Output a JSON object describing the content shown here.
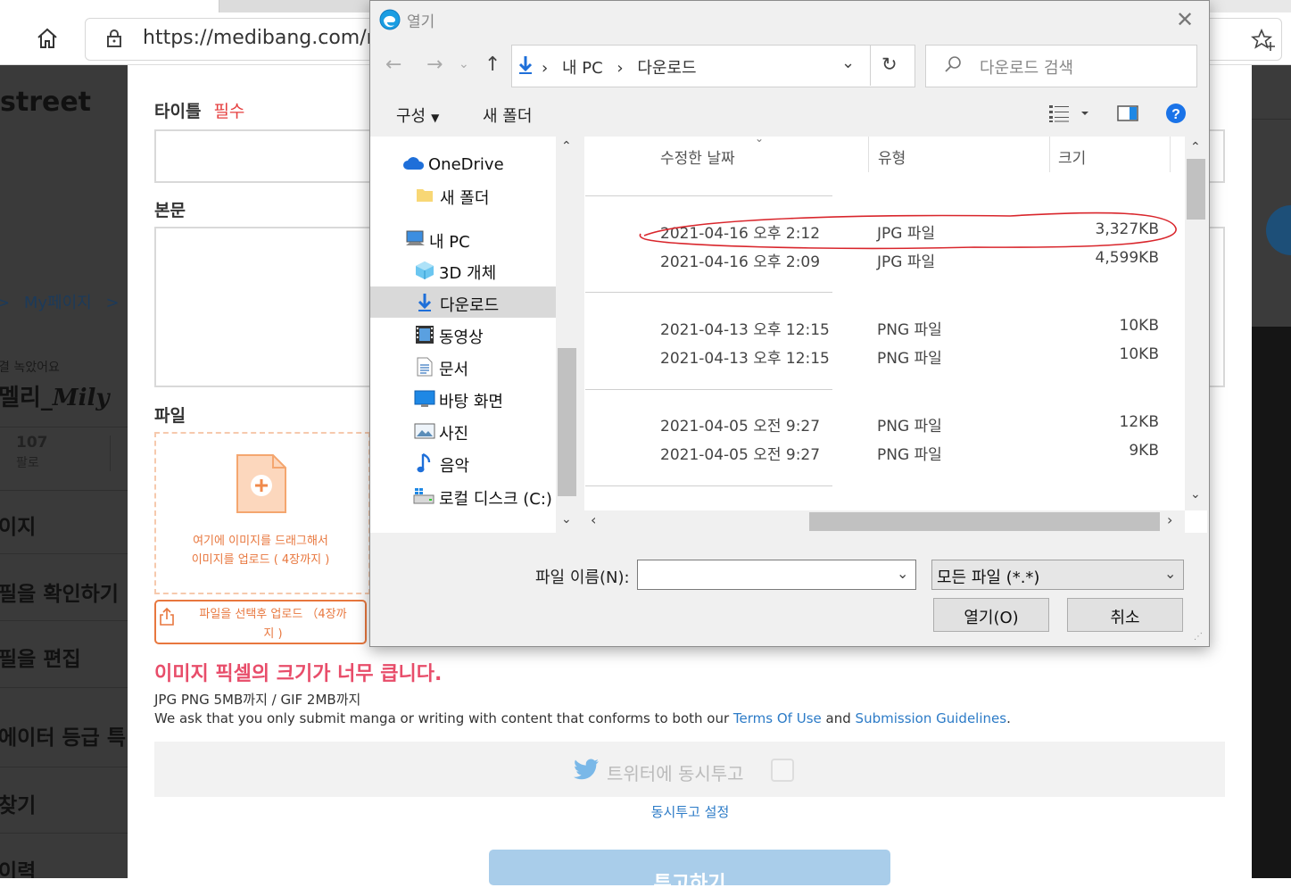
{
  "browser": {
    "url": "https://medibang.com/r"
  },
  "bg_page": {
    "brand_fragment": "street",
    "breadcrumb_sep": ">",
    "breadcrumb_mypage": "My페이지",
    "breadcrumb_sep2": ">",
    "status_fragment": "결 녹았어요",
    "username_fragment": "멜리_",
    "username_script": "Mily",
    "followers_count": "107",
    "followers_label": "팔로",
    "menu": [
      "이지",
      "필을 확인하기",
      "필을 편집",
      "에이터 등급 특",
      "찾기",
      "이력"
    ]
  },
  "form": {
    "title_label": "타이틀",
    "required_label": "필수",
    "body_label": "본문",
    "file_label": "파일",
    "dropzone_line1": "여기에 이미지를 드래그해서",
    "dropzone_line2": "이미지를 업로드 ( 4장까지 )",
    "upload_line1": "파일을 선택후 업로드 （4장까",
    "upload_line2": "지 )",
    "error_message": "이미지 픽셀의 크기가 너무 큽니다.",
    "format_note": "JPG PNG 5MB까지 / GIF 2MB까지",
    "submit_note_prefix": "We ask that you only submit manga or writing with content that conforms to both our",
    "terms_link": "Terms Of Use",
    "and_text": "and",
    "guidelines_link": "Submission Guidelines",
    "period": ".",
    "twitter_label": "트위터에 동시투고",
    "twitter_settings": "동시투고 설정",
    "submit_button": "투고하기"
  },
  "dialog": {
    "title": "열기",
    "path": [
      "내 PC",
      "다운로드"
    ],
    "search_placeholder": "다운로드 검색",
    "organize_label": "구성",
    "new_folder_label": "새 폴더",
    "nav_items": [
      {
        "label": "OneDrive",
        "icon": "cloud-icon"
      },
      {
        "label": "새 폴더",
        "icon": "folder-icon"
      },
      {
        "label": "내 PC",
        "icon": "computer-icon"
      },
      {
        "label": "3D 개체",
        "icon": "cube-icon"
      },
      {
        "label": "다운로드",
        "icon": "download-icon"
      },
      {
        "label": "동영상",
        "icon": "video-icon"
      },
      {
        "label": "문서",
        "icon": "document-icon"
      },
      {
        "label": "바탕 화면",
        "icon": "desktop-icon"
      },
      {
        "label": "사진",
        "icon": "picture-icon"
      },
      {
        "label": "음악",
        "icon": "music-icon"
      },
      {
        "label": "로컬 디스크 (C:)",
        "icon": "disk-icon"
      }
    ],
    "columns": [
      "수정한 날짜",
      "유형",
      "크기"
    ],
    "files": [
      {
        "date": "2021-04-16 오후 2:12",
        "type": "JPG 파일",
        "size": "3,327KB"
      },
      {
        "date": "2021-04-16 오후 2:09",
        "type": "JPG 파일",
        "size": "4,599KB"
      },
      {
        "date": "2021-04-13 오후 12:15",
        "type": "PNG 파일",
        "size": "10KB"
      },
      {
        "date": "2021-04-13 오후 12:15",
        "type": "PNG 파일",
        "size": "10KB"
      },
      {
        "date": "2021-04-05 오전 9:27",
        "type": "PNG 파일",
        "size": "12KB"
      },
      {
        "date": "2021-04-05 오전 9:27",
        "type": "PNG 파일",
        "size": "9KB"
      }
    ],
    "filename_label": "파일 이름(N):",
    "filename_value": "",
    "filetype_value": "모든 파일 (*.*)",
    "open_button": "열기(O)",
    "cancel_button": "취소"
  },
  "colors": {
    "accent_orange": "#e8773e",
    "error_pink": "#e84d6a",
    "link_blue": "#2c7bc7",
    "annotation_red": "#d9262c",
    "help_blue": "#1a73e8"
  }
}
